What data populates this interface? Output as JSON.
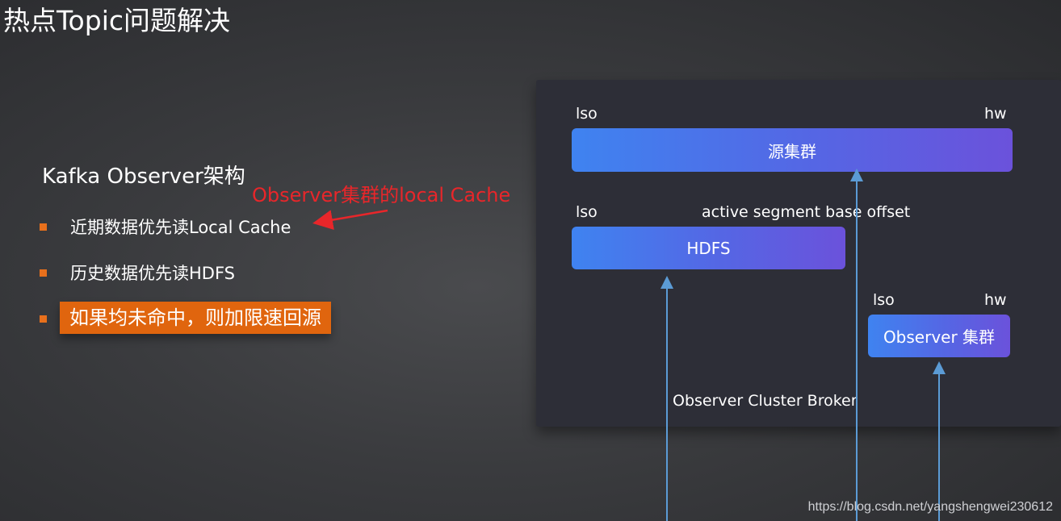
{
  "title": "热点Topic问题解决",
  "subtitle": "Kafka Observer架构",
  "annotation": "Observer集群的local Cache",
  "bullets": [
    "近期数据优先读Local Cache",
    "历史数据优先读HDFS",
    "如果均未命中，则加限速回源"
  ],
  "diagram": {
    "source_cluster": {
      "left_label": "lso",
      "right_label": "hw",
      "bar_label": "源集群"
    },
    "hdfs": {
      "left_label": "lso",
      "right_label": "active  segment base offset",
      "bar_label": "HDFS"
    },
    "observer_cluster": {
      "left_label": "lso",
      "right_label": "hw",
      "bar_label": "Observer 集群"
    },
    "broker_label": "Observer  Cluster Broker"
  },
  "watermark": "https://blog.csdn.net/yangshengwei230612",
  "colors": {
    "bullet": "#e8701c",
    "annotation": "#e8262a",
    "highlight_bg": "#e0650e",
    "bar_start": "#3f83f0",
    "bar_end": "#6b52db",
    "guide_line": "#5b9bd5"
  }
}
